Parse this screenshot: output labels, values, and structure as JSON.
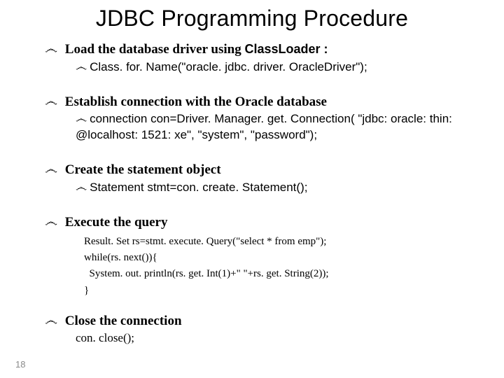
{
  "title": "JDBC Programming Procedure",
  "bullet": "෴",
  "items": {
    "load": {
      "lead_pre": "Load the database driver using ",
      "lead_code": "ClassLoader :",
      "sub": "Class. for. Name(\"oracle. jdbc. driver. OracleDriver\");"
    },
    "establish": {
      "lead": "Establish connection with the Oracle database",
      "sub": "connection con=Driver. Manager. get. Connection(  \"jdbc: oracle: thin: @localhost: 1521: xe\", \"system\", \"password\");"
    },
    "create": {
      "lead": "Create the statement object",
      "sub": "Statement stmt=con. create. Statement();"
    },
    "execute": {
      "lead": "Execute the query",
      "code": "Result. Set rs=stmt. execute. Query(\"select * from emp\");\nwhile(rs. next()){\n  System. out. println(rs. get. Int(1)+\" \"+rs. get. String(2));\n}"
    },
    "close": {
      "lead": "Close the connection",
      "code": "con. close();"
    }
  },
  "page_number": "18"
}
